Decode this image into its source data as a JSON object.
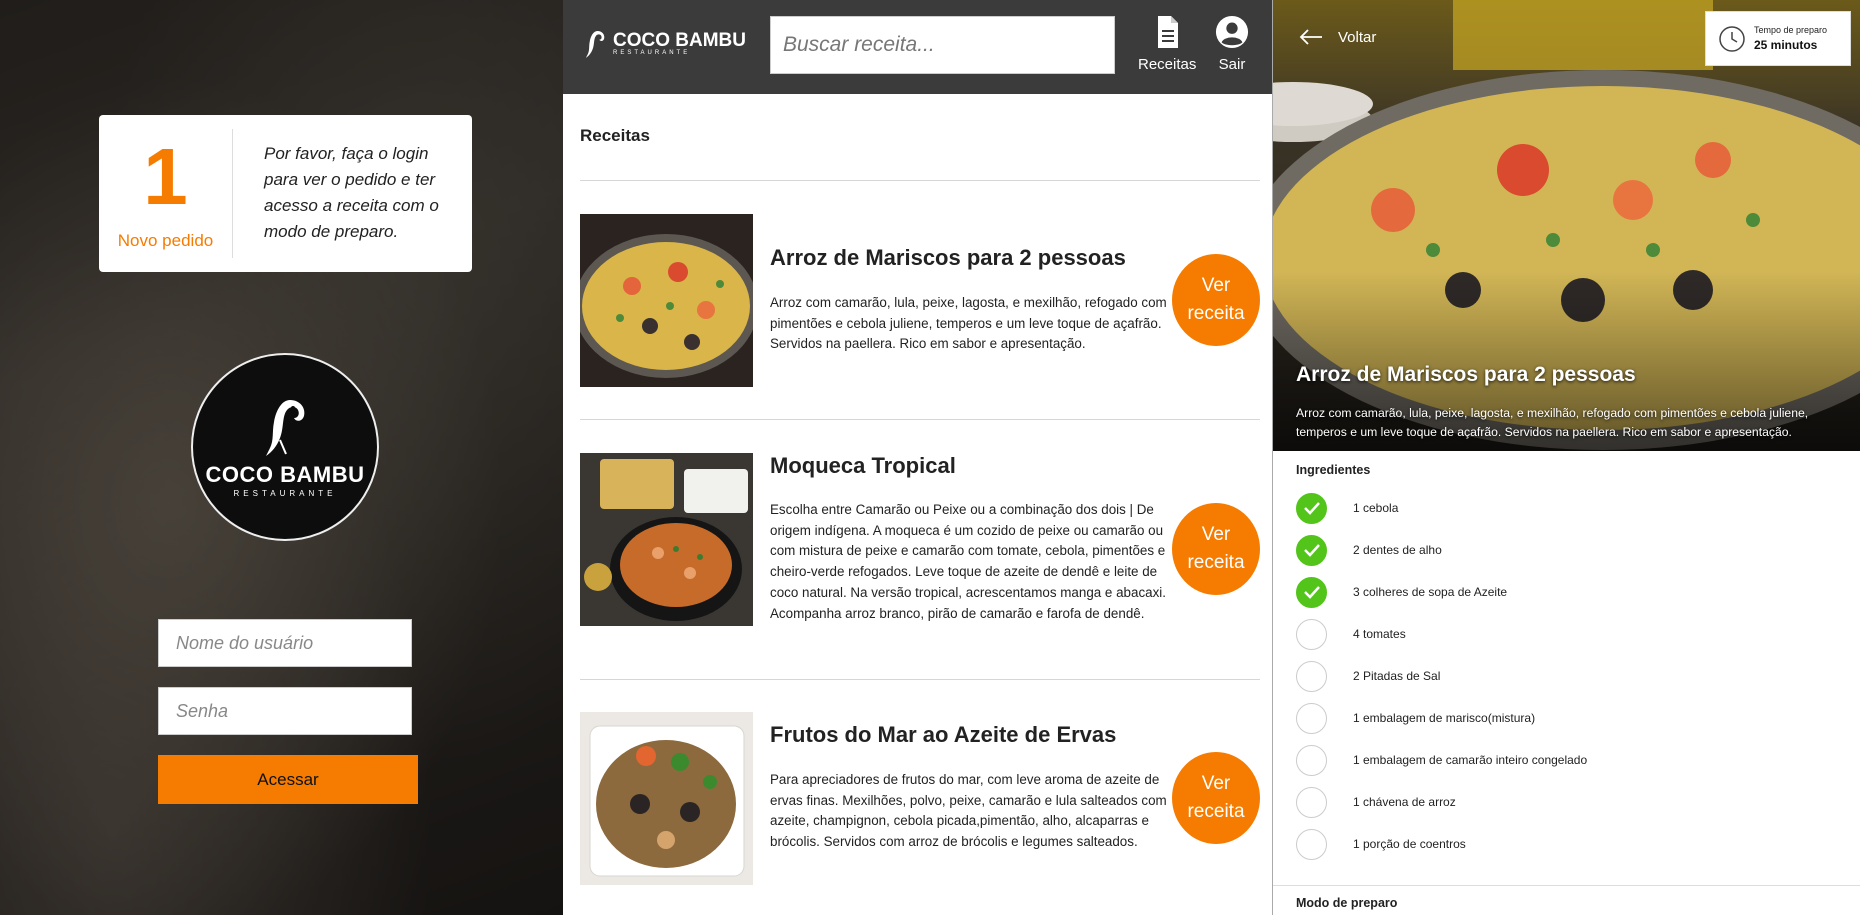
{
  "login": {
    "order_count": "1",
    "order_label": "Novo pedido",
    "message": "Por favor, faça o login para ver o pedido e ter acesso a receita com o modo de preparo.",
    "logo_name": "COCO BAMBU",
    "logo_sub": "RESTAURANTE",
    "username_placeholder": "Nome do usuário",
    "password_placeholder": "Senha",
    "submit_label": "Acessar"
  },
  "header": {
    "brand_name": "COCO BAMBU",
    "brand_sub": "RESTAURANTE",
    "search_placeholder": "Buscar receita...",
    "nav": [
      {
        "label": "Receitas",
        "icon": "document-icon"
      },
      {
        "label": "Sair",
        "icon": "user-icon"
      }
    ]
  },
  "list": {
    "title": "Receitas",
    "see_label": "Ver receita",
    "recipes": [
      {
        "title": "Arroz de Mariscos para 2 pessoas",
        "description": "Arroz com camarão, lula, peixe, lagosta, e mexilhão, refogado com pimentões e cebola juliene, temperos e um leve toque de açafrão. Servidos na paellera. Rico em sabor e apresentação."
      },
      {
        "title": "Moqueca Tropical",
        "description": "Escolha entre Camarão ou Peixe ou a combinação dos dois | De origem indígena. A moqueca é um cozido de peixe ou camarão ou com mistura de peixe e camarão com tomate, cebola, pimentões e cheiro-verde refogados. Leve toque de azeite de dendê e leite de coco natural. Na versão tropical, acrescentamos manga e abacaxi. Acompanha arroz branco, pirão de camarão e farofa de dendê."
      },
      {
        "title": "Frutos do Mar ao Azeite de Ervas",
        "description": "Para apreciadores de frutos do mar, com leve aroma de azeite de ervas finas. Mexilhões, polvo, peixe, camarão e lula salteados com azeite, champignon, cebola picada,pimentão, alho, alcaparras e brócolis. Servidos com arroz de brócolis e legumes salteados."
      }
    ]
  },
  "detail": {
    "back_label": "Voltar",
    "time_label": "Tempo de preparo",
    "time_value": "25 minutos",
    "title": "Arroz de Mariscos para 2 pessoas",
    "description": "Arroz com camarão, lula, peixe, lagosta, e mexilhão, refogado com pimentões e cebola juliene, temperos e um leve toque de açafrão. Servidos na paellera. Rico em sabor e apresentação.",
    "ingredients_title": "Ingredientes",
    "ingredients": [
      {
        "label": "1 cebola",
        "checked": true
      },
      {
        "label": "2 dentes de alho",
        "checked": true
      },
      {
        "label": "3 colheres de sopa de Azeite",
        "checked": true
      },
      {
        "label": "4 tomates",
        "checked": false
      },
      {
        "label": "2 Pitadas de Sal",
        "checked": false
      },
      {
        "label": "1 embalagem de marisco(mistura)",
        "checked": false
      },
      {
        "label": "1 embalagem de camarão inteiro congelado",
        "checked": false
      },
      {
        "label": "1 chávena de arroz",
        "checked": false
      },
      {
        "label": "1 porção de coentros",
        "checked": false
      }
    ],
    "prep_title": "Modo de preparo"
  },
  "colors": {
    "accent": "#f57c00",
    "header_bg": "#3b3b3b",
    "check_on": "#52c41a"
  }
}
